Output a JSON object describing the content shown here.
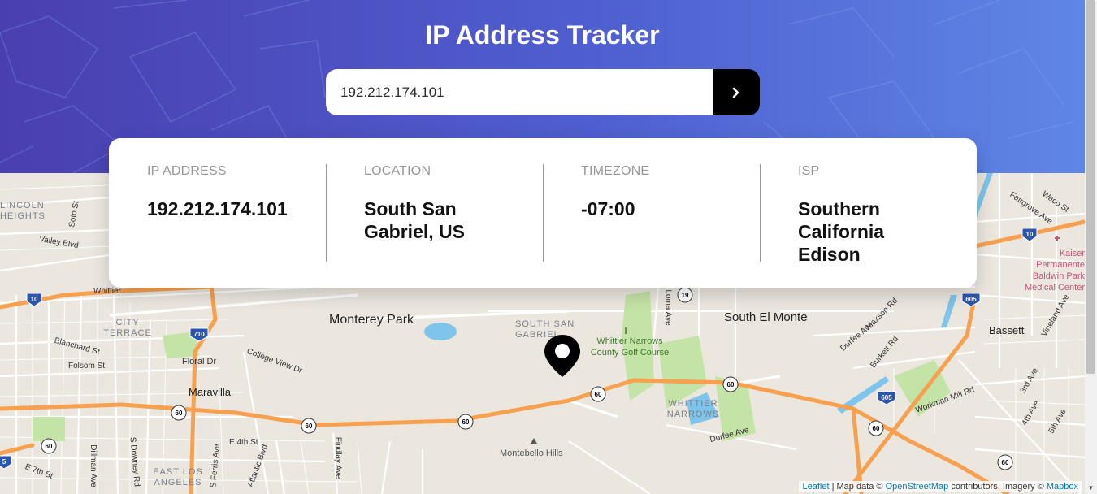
{
  "header": {
    "title": "IP Address Tracker"
  },
  "search": {
    "value": "192.212.174.101",
    "submit_icon": "chevron-right-icon"
  },
  "info": [
    {
      "label": "IP Address",
      "value": "192.212.174.101"
    },
    {
      "label": "Location",
      "value": "South San Gabriel, US"
    },
    {
      "label": "Timezone",
      "value": "-07:00"
    },
    {
      "label": "ISP",
      "value": "Southern California Edison"
    }
  ],
  "map": {
    "places": {
      "monterey_park": "Monterey Park",
      "south_el_monte": "South El Monte",
      "south_san_gabriel": "SOUTH SAN GABRIEL",
      "whittier_golf": "Whittier Narrows County Golf Course",
      "whittier_narrows": "WHITTIER NARROWS",
      "maravilla": "Maravilla",
      "city_terrace": "CITY TERRACE",
      "east_los_angeles": "EAST LOS ANGELES",
      "montebello_hills": "Montebello Hills",
      "bassett": "Bassett",
      "lincoln_heights": "LINCOLN HEIGHTS",
      "kaiser": "Kaiser Permanente Baldwin Park Medical Center"
    },
    "streets": {
      "valley_blvd": "Valley Blvd",
      "soto_st": "Soto St",
      "whittier": "Whittier",
      "blanchard": "Blanchard St",
      "folsom": "Folsom St",
      "floral": "Floral Dr",
      "college_view": "College View Dr",
      "durfee_ave": "Durfee Ave",
      "durfee_ave2": "Durfee Ave",
      "burkett": "Burkett Rd",
      "workman_mill": "Workman Mill Rd",
      "loma": "Loma Ave",
      "maxson": "Maxson Rd",
      "vineland": "Vineland Ave",
      "fairgrove": "Fairgrove Ave",
      "waco": "Waco St",
      "dillman": "Dillman Ave",
      "downey": "S Downey Rd",
      "ferris": "S Ferris Ave",
      "atlantic": "Atlantic Blvd",
      "findlay": "Findlay Ave",
      "e4th": "E 4th St",
      "e7th": "E 7th St",
      "third_ave": "3rd Ave",
      "fourth_ave": "4th Ave",
      "fifth_ave": "5th Ave"
    },
    "shields": [
      "60",
      "60",
      "60",
      "60",
      "60",
      "60",
      "60",
      "60",
      "19",
      "710",
      "10",
      "10",
      "605",
      "605",
      "5"
    ],
    "attribution": {
      "leaflet": "Leaflet",
      "data_text": "| Map data ©",
      "osm": "OpenStreetMap",
      "contrib": "contributors, Imagery ©",
      "mapbox": "Mapbox"
    }
  },
  "colors": {
    "accent": "#000000",
    "header_start": "#4a3fb0",
    "header_end": "#5f86e6",
    "freeway": "#f7a050",
    "park": "#c4e3a6",
    "water": "#7fc4ea"
  }
}
